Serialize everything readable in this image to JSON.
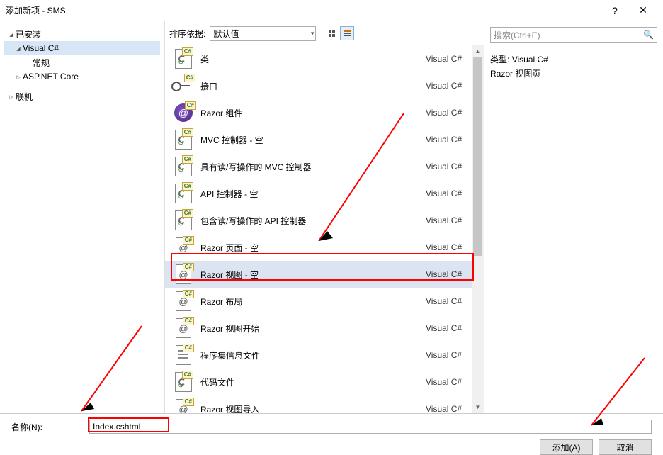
{
  "title": "添加新项 - SMS",
  "help_symbol": "?",
  "close_symbol": "✕",
  "tree": {
    "installed": "已安装",
    "visual_csharp": "Visual C#",
    "general": "常规",
    "aspnet_core": "ASP.NET Core",
    "online": "联机"
  },
  "toolbar": {
    "sort_label": "排序依据:",
    "sort_value": "默认值"
  },
  "search": {
    "placeholder": "搜索(Ctrl+E)"
  },
  "items": [
    {
      "name": "类",
      "lang": "Visual C#",
      "icon": "cs"
    },
    {
      "name": "接口",
      "lang": "Visual C#",
      "icon": "interface"
    },
    {
      "name": "Razor 组件",
      "lang": "Visual C#",
      "icon": "razor"
    },
    {
      "name": "MVC 控制器 - 空",
      "lang": "Visual C#",
      "icon": "cs"
    },
    {
      "name": "具有读/写操作的 MVC 控制器",
      "lang": "Visual C#",
      "icon": "cs"
    },
    {
      "name": "API 控制器 - 空",
      "lang": "Visual C#",
      "icon": "cs"
    },
    {
      "name": "包含读/写操作的 API 控制器",
      "lang": "Visual C#",
      "icon": "cs"
    },
    {
      "name": "Razor 页面 - 空",
      "lang": "Visual C#",
      "icon": "at"
    },
    {
      "name": "Razor 视图 - 空",
      "lang": "Visual C#",
      "icon": "at",
      "selected": true
    },
    {
      "name": "Razor 布局",
      "lang": "Visual C#",
      "icon": "at"
    },
    {
      "name": "Razor 视图开始",
      "lang": "Visual C#",
      "icon": "at"
    },
    {
      "name": "程序集信息文件",
      "lang": "Visual C#",
      "icon": "doc"
    },
    {
      "name": "代码文件",
      "lang": "Visual C#",
      "icon": "cs"
    },
    {
      "name": "Razor 视图导入",
      "lang": "Visual C#",
      "icon": "at"
    }
  ],
  "detail": {
    "type_label": "类型:",
    "type_value": "Visual C#",
    "desc": "Razor 视图页"
  },
  "name_field": {
    "label": "名称(N):",
    "value": "Index.cshtml"
  },
  "buttons": {
    "add": "添加(A)",
    "cancel": "取消"
  }
}
